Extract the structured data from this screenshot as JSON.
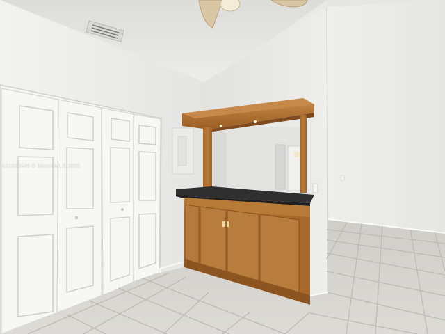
{
  "photo": {
    "subject": "vacant interior room",
    "features": [
      "white bifold closet doors",
      "wood kitchen pass-through bar with dark countertop",
      "ceiling fan",
      "air vent",
      "light tile floor"
    ],
    "watermark": "A11836546 © Miami MLS 2025"
  },
  "colors": {
    "wall": "#ececea",
    "ceiling": "#ebebe8",
    "wood": "#b06f2c",
    "countertop": "#2f2f30",
    "tile": "#d9d8d3",
    "door": "#f6f6f4"
  }
}
